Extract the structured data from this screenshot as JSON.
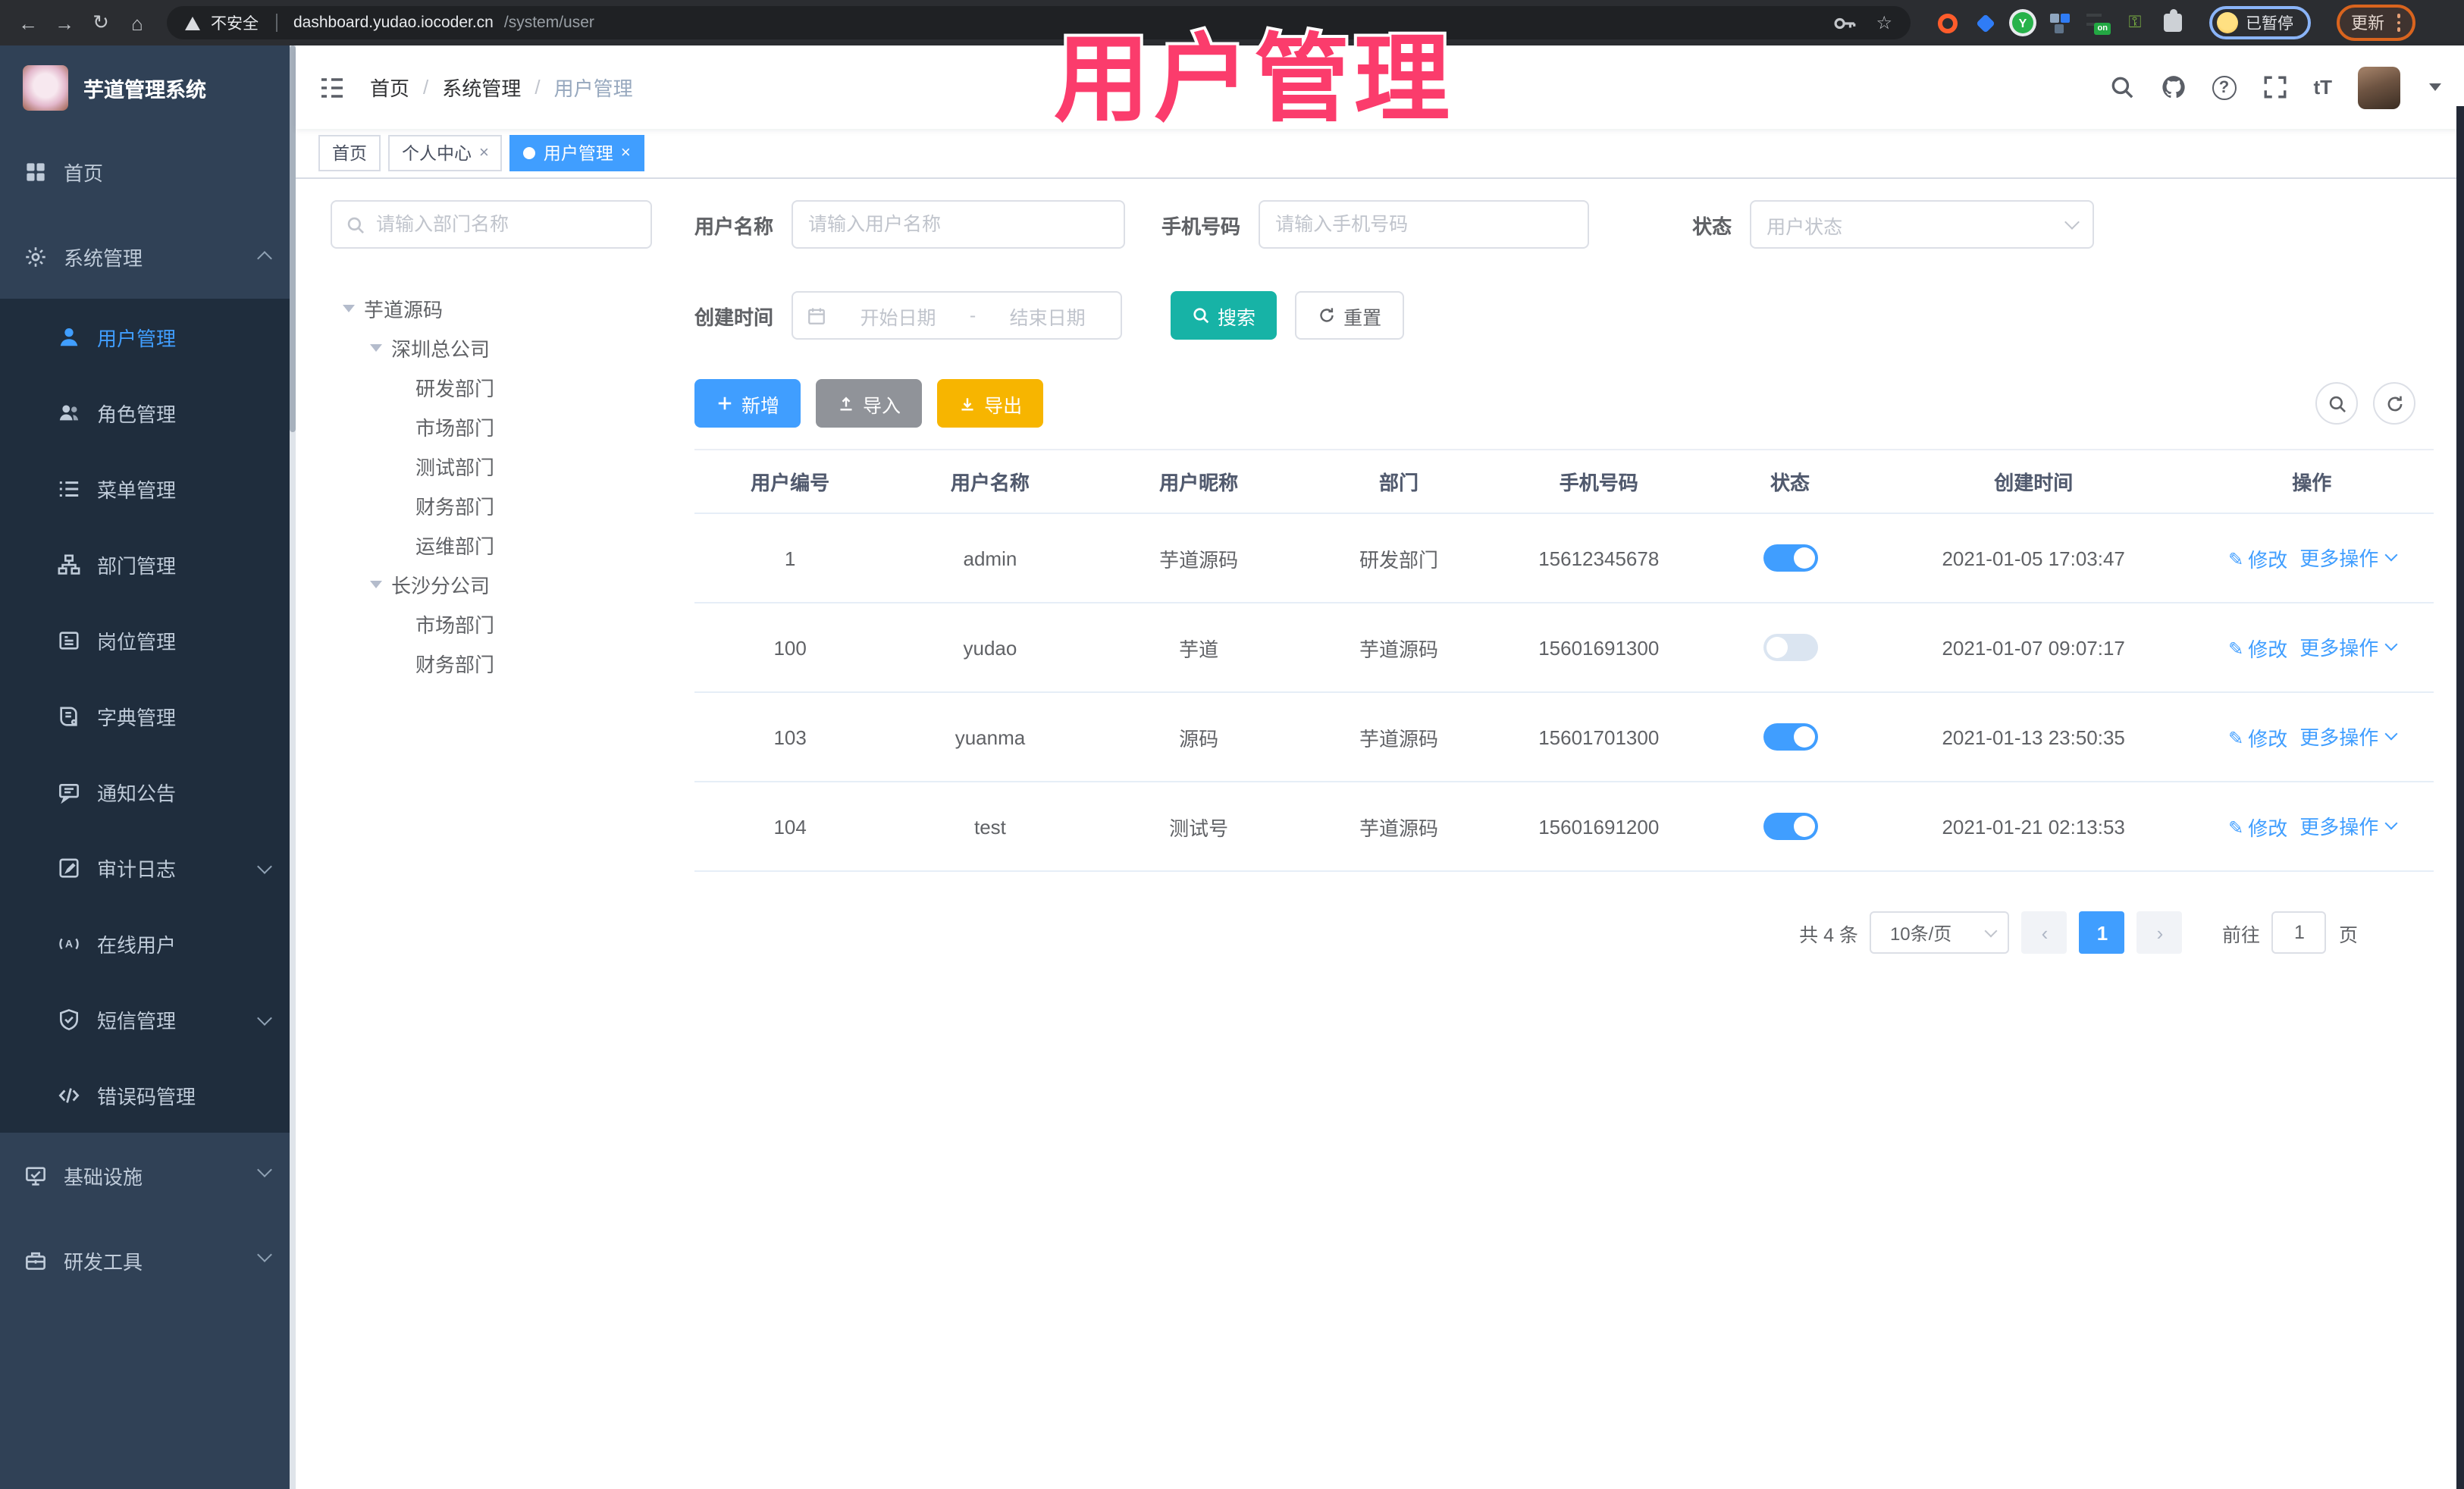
{
  "browser": {
    "security_label": "不安全",
    "url_host": "dashboard.yudao.iocoder.cn",
    "url_path": "/system/user",
    "profile_chip": "已暂停",
    "update_button": "更新"
  },
  "overlay": {
    "title": "用户管理",
    "color": "#fb3c6c"
  },
  "sidebar": {
    "logo_title": "芋道管理系统",
    "items": [
      {
        "label": "首页"
      },
      {
        "label": "系统管理"
      },
      {
        "label": "基础设施"
      },
      {
        "label": "研发工具"
      }
    ],
    "submenu": [
      {
        "label": "用户管理"
      },
      {
        "label": "角色管理"
      },
      {
        "label": "菜单管理"
      },
      {
        "label": "部门管理"
      },
      {
        "label": "岗位管理"
      },
      {
        "label": "字典管理"
      },
      {
        "label": "通知公告"
      },
      {
        "label": "审计日志"
      },
      {
        "label": "在线用户"
      },
      {
        "label": "短信管理"
      },
      {
        "label": "错误码管理"
      }
    ]
  },
  "navbar": {
    "breadcrumb": [
      "首页",
      "系统管理",
      "用户管理"
    ],
    "separator": "/"
  },
  "tags": [
    {
      "label": "首页"
    },
    {
      "label": "个人中心",
      "close": "×"
    },
    {
      "label": "用户管理",
      "close": "×"
    }
  ],
  "tree": {
    "search_placeholder": "请输入部门名称",
    "nodes": [
      {
        "label": "芋道源码",
        "level": 0,
        "caret": true
      },
      {
        "label": "深圳总公司",
        "level": 1,
        "caret": true
      },
      {
        "label": "研发部门",
        "level": 2,
        "caret": false
      },
      {
        "label": "市场部门",
        "level": 2,
        "caret": false
      },
      {
        "label": "测试部门",
        "level": 2,
        "caret": false
      },
      {
        "label": "财务部门",
        "level": 2,
        "caret": false
      },
      {
        "label": "运维部门",
        "level": 2,
        "caret": false
      },
      {
        "label": "长沙分公司",
        "level": 1,
        "caret": true
      },
      {
        "label": "市场部门",
        "level": 2,
        "caret": false
      },
      {
        "label": "财务部门",
        "level": 2,
        "caret": false
      }
    ]
  },
  "filters": {
    "username_label": "用户名称",
    "username_placeholder": "请输入用户名称",
    "mobile_label": "手机号码",
    "mobile_placeholder": "请输入手机号码",
    "status_label": "状态",
    "status_placeholder": "用户状态",
    "created_label": "创建时间",
    "date_start_placeholder": "开始日期",
    "date_separator": "-",
    "date_end_placeholder": "结束日期",
    "search_button": "搜索",
    "reset_button": "重置"
  },
  "toolbar": {
    "add": "新增",
    "import": "导入",
    "export": "导出"
  },
  "table": {
    "columns": [
      "用户编号",
      "用户名称",
      "用户昵称",
      "部门",
      "手机号码",
      "状态",
      "创建时间",
      "操作"
    ],
    "action_edit": "修改",
    "action_more": "更多操作",
    "rows": [
      {
        "id": "1",
        "username": "admin",
        "nickname": "芋道源码",
        "dept": "研发部门",
        "mobile": "15612345678",
        "status": true,
        "created": "2021-01-05 17:03:47"
      },
      {
        "id": "100",
        "username": "yudao",
        "nickname": "芋道",
        "dept": "芋道源码",
        "mobile": "15601691300",
        "status": false,
        "created": "2021-01-07 09:07:17"
      },
      {
        "id": "103",
        "username": "yuanma",
        "nickname": "源码",
        "dept": "芋道源码",
        "mobile": "15601701300",
        "status": true,
        "created": "2021-01-13 23:50:35"
      },
      {
        "id": "104",
        "username": "test",
        "nickname": "测试号",
        "dept": "芋道源码",
        "mobile": "15601691200",
        "status": true,
        "created": "2021-01-21 02:13:53"
      }
    ]
  },
  "pagination": {
    "total": "共 4 条",
    "page_size": "10条/页",
    "current": "1",
    "goto_label": "前往",
    "goto_value": "1",
    "unit": "页"
  },
  "colors": {
    "accent": "#409eff",
    "search_button": "#17b3a6",
    "export_button": "#f7b500",
    "import_button": "#909399",
    "overlay_pink": "#fb3c6c",
    "sidebar_bg": "#304156",
    "submenu_bg": "#1f2d3d",
    "switch_on": "#409eff"
  },
  "icons": {
    "chrome": [
      "back",
      "forward",
      "reload",
      "home",
      "warning-triangle",
      "key",
      "star",
      "extensions-puzzle",
      "profile-face",
      "kebab-menu"
    ],
    "sidebar": [
      "dashboard",
      "gear",
      "user",
      "users",
      "menu-list",
      "dept-tree",
      "post-badge",
      "dict-book",
      "notice-bubble",
      "audit-log",
      "online-signal",
      "sms-shield",
      "error-code",
      "infra-monitor",
      "dev-toolbox"
    ],
    "navbar": [
      "hamburger",
      "search",
      "github",
      "help",
      "fullscreen",
      "font-size",
      "caret-down"
    ],
    "actions": [
      "plus",
      "upload",
      "download",
      "magnifier",
      "refresh",
      "calendar",
      "edit-pencil"
    ]
  }
}
